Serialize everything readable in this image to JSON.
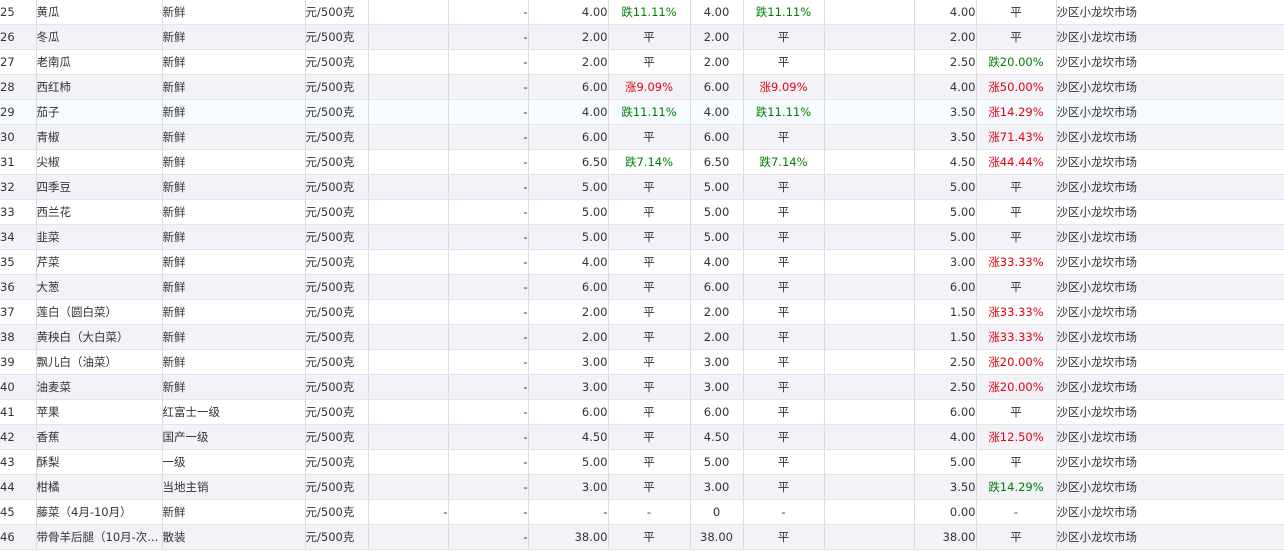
{
  "columns": [
    "no",
    "name",
    "spec",
    "unit",
    "c4",
    "c5",
    "price_a",
    "change_a",
    "price_b",
    "change_b",
    "c10",
    "price_c",
    "change_c",
    "market"
  ],
  "colors": {
    "up": "#e4000f",
    "down": "#008000",
    "row_alt": "#f2f2f8"
  },
  "rows": [
    {
      "no": "25",
      "name": "黄瓜",
      "spec": "新鲜",
      "unit": "元/500克",
      "c4": "",
      "c5": "-",
      "price_a": "4.00",
      "change_a": "跌11.11%",
      "price_b": "4.00",
      "change_b": "跌11.11%",
      "c10": "",
      "price_c": "4.00",
      "change_c": "平",
      "market": "沙区小龙坎市场"
    },
    {
      "no": "26",
      "name": "冬瓜",
      "spec": "新鲜",
      "unit": "元/500克",
      "c4": "",
      "c5": "-",
      "price_a": "2.00",
      "change_a": "平",
      "price_b": "2.00",
      "change_b": "平",
      "c10": "",
      "price_c": "2.00",
      "change_c": "平",
      "market": "沙区小龙坎市场"
    },
    {
      "no": "27",
      "name": "老南瓜",
      "spec": "新鲜",
      "unit": "元/500克",
      "c4": "",
      "c5": "-",
      "price_a": "2.00",
      "change_a": "平",
      "price_b": "2.00",
      "change_b": "平",
      "c10": "",
      "price_c": "2.50",
      "change_c": "跌20.00%",
      "market": "沙区小龙坎市场"
    },
    {
      "no": "28",
      "name": "西红柿",
      "spec": "新鲜",
      "unit": "元/500克",
      "c4": "",
      "c5": "-",
      "price_a": "6.00",
      "change_a": "涨9.09%",
      "price_b": "6.00",
      "change_b": "涨9.09%",
      "c10": "",
      "price_c": "4.00",
      "change_c": "涨50.00%",
      "market": "沙区小龙坎市场"
    },
    {
      "no": "29",
      "name": "茄子",
      "spec": "新鲜",
      "unit": "元/500克",
      "c4": "",
      "c5": "-",
      "price_a": "4.00",
      "change_a": "跌11.11%",
      "price_b": "4.00",
      "change_b": "跌11.11%",
      "c10": "",
      "price_c": "3.50",
      "change_c": "涨14.29%",
      "market": "沙区小龙坎市场"
    },
    {
      "no": "30",
      "name": "青椒",
      "spec": "新鲜",
      "unit": "元/500克",
      "c4": "",
      "c5": "-",
      "price_a": "6.00",
      "change_a": "平",
      "price_b": "6.00",
      "change_b": "平",
      "c10": "",
      "price_c": "3.50",
      "change_c": "涨71.43%",
      "market": "沙区小龙坎市场"
    },
    {
      "no": "31",
      "name": "尖椒",
      "spec": "新鲜",
      "unit": "元/500克",
      "c4": "",
      "c5": "-",
      "price_a": "6.50",
      "change_a": "跌7.14%",
      "price_b": "6.50",
      "change_b": "跌7.14%",
      "c10": "",
      "price_c": "4.50",
      "change_c": "涨44.44%",
      "market": "沙区小龙坎市场"
    },
    {
      "no": "32",
      "name": "四季豆",
      "spec": "新鲜",
      "unit": "元/500克",
      "c4": "",
      "c5": "-",
      "price_a": "5.00",
      "change_a": "平",
      "price_b": "5.00",
      "change_b": "平",
      "c10": "",
      "price_c": "5.00",
      "change_c": "平",
      "market": "沙区小龙坎市场"
    },
    {
      "no": "33",
      "name": "西兰花",
      "spec": "新鲜",
      "unit": "元/500克",
      "c4": "",
      "c5": "-",
      "price_a": "5.00",
      "change_a": "平",
      "price_b": "5.00",
      "change_b": "平",
      "c10": "",
      "price_c": "5.00",
      "change_c": "平",
      "market": "沙区小龙坎市场"
    },
    {
      "no": "34",
      "name": "韭菜",
      "spec": "新鲜",
      "unit": "元/500克",
      "c4": "",
      "c5": "-",
      "price_a": "5.00",
      "change_a": "平",
      "price_b": "5.00",
      "change_b": "平",
      "c10": "",
      "price_c": "5.00",
      "change_c": "平",
      "market": "沙区小龙坎市场"
    },
    {
      "no": "35",
      "name": "芹菜",
      "spec": "新鲜",
      "unit": "元/500克",
      "c4": "",
      "c5": "-",
      "price_a": "4.00",
      "change_a": "平",
      "price_b": "4.00",
      "change_b": "平",
      "c10": "",
      "price_c": "3.00",
      "change_c": "涨33.33%",
      "market": "沙区小龙坎市场"
    },
    {
      "no": "36",
      "name": "大葱",
      "spec": "新鲜",
      "unit": "元/500克",
      "c4": "",
      "c5": "-",
      "price_a": "6.00",
      "change_a": "平",
      "price_b": "6.00",
      "change_b": "平",
      "c10": "",
      "price_c": "6.00",
      "change_c": "平",
      "market": "沙区小龙坎市场"
    },
    {
      "no": "37",
      "name": "莲白（圆白菜）",
      "spec": "新鲜",
      "unit": "元/500克",
      "c4": "",
      "c5": "-",
      "price_a": "2.00",
      "change_a": "平",
      "price_b": "2.00",
      "change_b": "平",
      "c10": "",
      "price_c": "1.50",
      "change_c": "涨33.33%",
      "market": "沙区小龙坎市场"
    },
    {
      "no": "38",
      "name": "黄秧白（大白菜）",
      "spec": "新鲜",
      "unit": "元/500克",
      "c4": "",
      "c5": "-",
      "price_a": "2.00",
      "change_a": "平",
      "price_b": "2.00",
      "change_b": "平",
      "c10": "",
      "price_c": "1.50",
      "change_c": "涨33.33%",
      "market": "沙区小龙坎市场"
    },
    {
      "no": "39",
      "name": "飘儿白（油菜）",
      "spec": "新鲜",
      "unit": "元/500克",
      "c4": "",
      "c5": "-",
      "price_a": "3.00",
      "change_a": "平",
      "price_b": "3.00",
      "change_b": "平",
      "c10": "",
      "price_c": "2.50",
      "change_c": "涨20.00%",
      "market": "沙区小龙坎市场"
    },
    {
      "no": "40",
      "name": "油麦菜",
      "spec": "新鲜",
      "unit": "元/500克",
      "c4": "",
      "c5": "-",
      "price_a": "3.00",
      "change_a": "平",
      "price_b": "3.00",
      "change_b": "平",
      "c10": "",
      "price_c": "2.50",
      "change_c": "涨20.00%",
      "market": "沙区小龙坎市场"
    },
    {
      "no": "41",
      "name": "苹果",
      "spec": "红富士一级",
      "unit": "元/500克",
      "c4": "",
      "c5": "-",
      "price_a": "6.00",
      "change_a": "平",
      "price_b": "6.00",
      "change_b": "平",
      "c10": "",
      "price_c": "6.00",
      "change_c": "平",
      "market": "沙区小龙坎市场"
    },
    {
      "no": "42",
      "name": "香蕉",
      "spec": "国产一级",
      "unit": "元/500克",
      "c4": "",
      "c5": "-",
      "price_a": "4.50",
      "change_a": "平",
      "price_b": "4.50",
      "change_b": "平",
      "c10": "",
      "price_c": "4.00",
      "change_c": "涨12.50%",
      "market": "沙区小龙坎市场"
    },
    {
      "no": "43",
      "name": "酥梨",
      "spec": "一级",
      "unit": "元/500克",
      "c4": "",
      "c5": "-",
      "price_a": "5.00",
      "change_a": "平",
      "price_b": "5.00",
      "change_b": "平",
      "c10": "",
      "price_c": "5.00",
      "change_c": "平",
      "market": "沙区小龙坎市场"
    },
    {
      "no": "44",
      "name": "柑橘",
      "spec": "当地主销",
      "unit": "元/500克",
      "c4": "",
      "c5": "-",
      "price_a": "3.00",
      "change_a": "平",
      "price_b": "3.00",
      "change_b": "平",
      "c10": "",
      "price_c": "3.50",
      "change_c": "跌14.29%",
      "market": "沙区小龙坎市场"
    },
    {
      "no": "45",
      "name": "藤菜（4月-10月）",
      "spec": "新鲜",
      "unit": "元/500克",
      "c4": "-",
      "c5": "-",
      "price_a": "-",
      "change_a": "-",
      "price_b": "0",
      "change_b": "-",
      "c10": "",
      "price_c": "0.00",
      "change_c": "-",
      "market": "沙区小龙坎市场"
    },
    {
      "no": "46",
      "name": "带骨羊后腿（10月-次...",
      "spec": "散装",
      "unit": "元/500克",
      "c4": "",
      "c5": "-",
      "price_a": "38.00",
      "change_a": "平",
      "price_b": "38.00",
      "change_b": "平",
      "c10": "",
      "price_c": "38.00",
      "change_c": "平",
      "market": "沙区小龙坎市场"
    }
  ]
}
